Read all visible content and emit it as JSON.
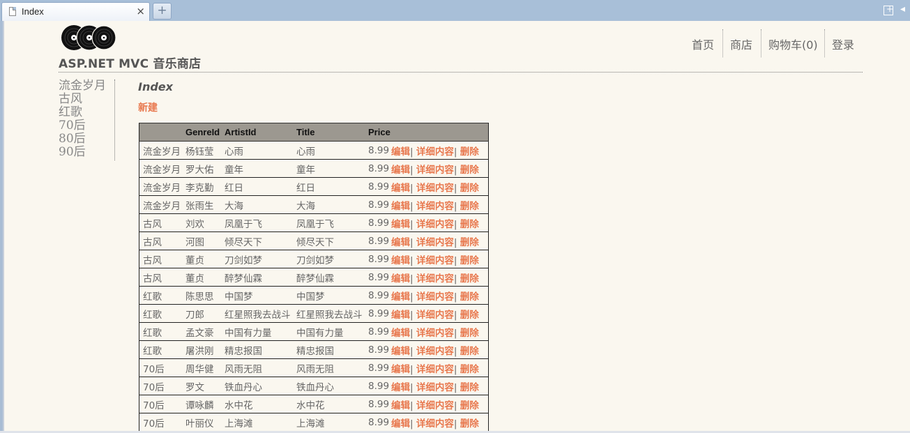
{
  "browser": {
    "tab_title": "Index",
    "tab_close": "×",
    "new_tab": "+",
    "right_icons": [
      "new-window-icon",
      "back-arrow-icon"
    ]
  },
  "header": {
    "logo_icon": "vinyl-records-logo",
    "site_title": "ASP.NET MVC 音乐商店",
    "nav": [
      "首页",
      "商店",
      "购物车(0)",
      "登录"
    ]
  },
  "sidebar": {
    "genres": [
      "流金岁月",
      "古风",
      "红歌",
      "70后",
      "80后",
      "90后"
    ]
  },
  "main": {
    "heading": "Index",
    "create_link": "新建",
    "columns": [
      "",
      "GenreId",
      "ArtistId",
      "Title",
      "Price",
      ""
    ],
    "actions": {
      "edit": "编辑",
      "details": "详细内容",
      "delete": "删除",
      "separator": "|"
    },
    "rows": [
      {
        "genre": "流金岁月",
        "artist": "杨钰莹",
        "title_a": "心雨",
        "title_b": "心雨",
        "price": "8.99"
      },
      {
        "genre": "流金岁月",
        "artist": "罗大佑",
        "title_a": "童年",
        "title_b": "童年",
        "price": "8.99"
      },
      {
        "genre": "流金岁月",
        "artist": "李克勤",
        "title_a": "红日",
        "title_b": "红日",
        "price": "8.99"
      },
      {
        "genre": "流金岁月",
        "artist": "张雨生",
        "title_a": "大海",
        "title_b": "大海",
        "price": "8.99"
      },
      {
        "genre": "古风",
        "artist": "刘欢",
        "title_a": "凤凰于飞",
        "title_b": "凤凰于飞",
        "price": "8.99"
      },
      {
        "genre": "古风",
        "artist": "河图",
        "title_a": "倾尽天下",
        "title_b": "倾尽天下",
        "price": "8.99"
      },
      {
        "genre": "古风",
        "artist": "董贞",
        "title_a": "刀剑如梦",
        "title_b": "刀剑如梦",
        "price": "8.99"
      },
      {
        "genre": "古风",
        "artist": "董贞",
        "title_a": "醉梦仙霖",
        "title_b": "醉梦仙霖",
        "price": "8.99"
      },
      {
        "genre": "红歌",
        "artist": "陈思思",
        "title_a": "中国梦",
        "title_b": "中国梦",
        "price": "8.99"
      },
      {
        "genre": "红歌",
        "artist": "刀郎",
        "title_a": "红星照我去战斗",
        "title_b": "红星照我去战斗",
        "price": "8.99"
      },
      {
        "genre": "红歌",
        "artist": "孟文豪",
        "title_a": "中国有力量",
        "title_b": "中国有力量",
        "price": "8.99"
      },
      {
        "genre": "红歌",
        "artist": "屠洪刚",
        "title_a": "精忠报国",
        "title_b": "精忠报国",
        "price": "8.99"
      },
      {
        "genre": "70后",
        "artist": "周华健",
        "title_a": "风雨无阻",
        "title_b": "风雨无阻",
        "price": "8.99"
      },
      {
        "genre": "70后",
        "artist": "罗文",
        "title_a": "铁血丹心",
        "title_b": "铁血丹心",
        "price": "8.99"
      },
      {
        "genre": "70后",
        "artist": "谭咏麟",
        "title_a": "水中花",
        "title_b": "水中花",
        "price": "8.99"
      },
      {
        "genre": "70后",
        "artist": "叶丽仪",
        "title_a": "上海滩",
        "title_b": "上海滩",
        "price": "8.99"
      }
    ]
  },
  "colors": {
    "accent": "#e8784e",
    "page_background": "#faf7ef",
    "table_header": "#9c9890",
    "chrome": "#a8bfd8"
  }
}
